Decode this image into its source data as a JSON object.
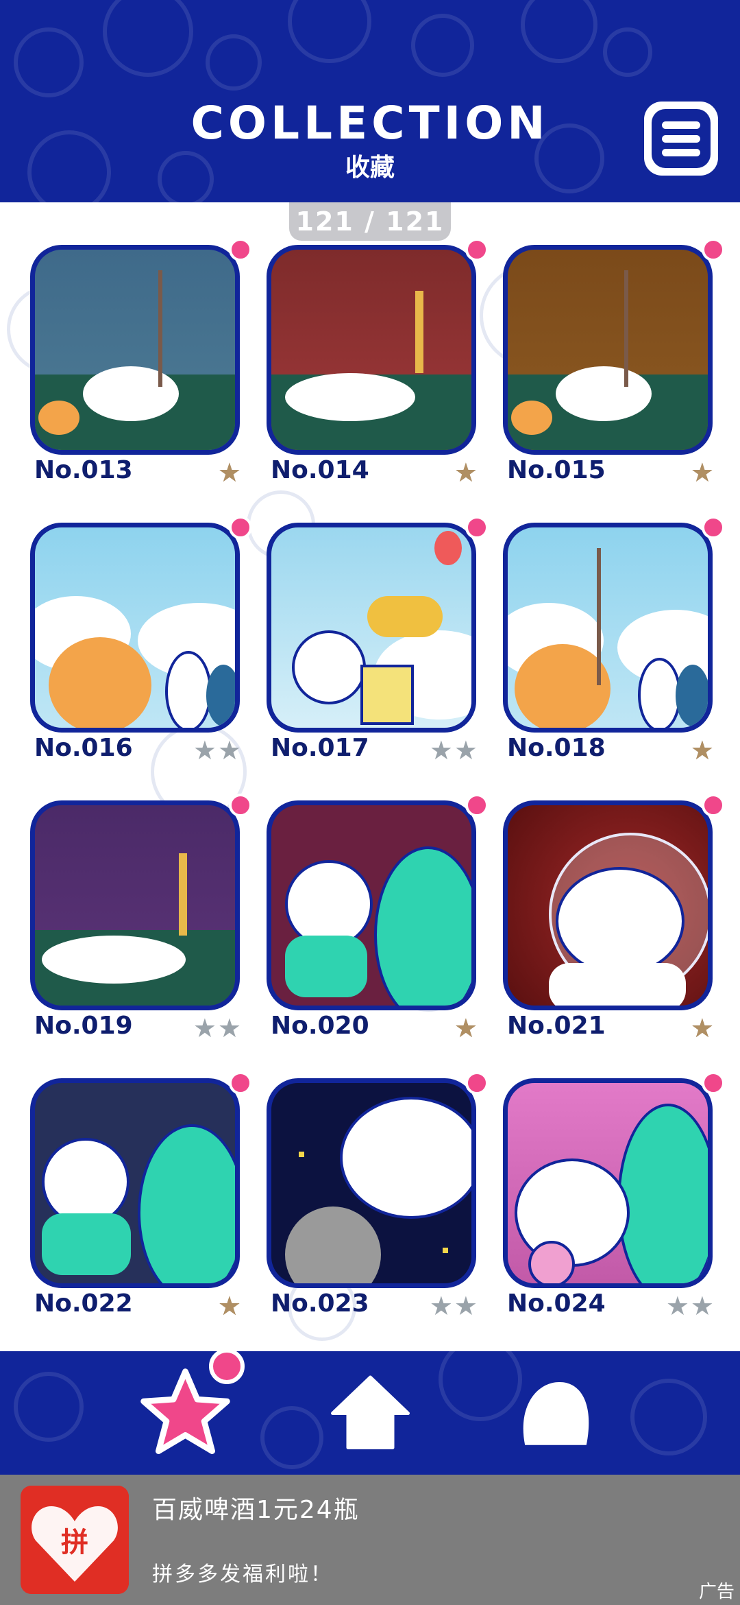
{
  "header": {
    "title": "COLLECTION",
    "subtitle": "收藏",
    "menu_icon": "hamburger-menu-icon",
    "background_color": "#11259a"
  },
  "counter": "121 / 121",
  "cards": [
    {
      "number": "No.013",
      "stars": "gold",
      "star_count": 1,
      "new_dot": true,
      "scene": "dog-sleeping-tree-night"
    },
    {
      "number": "No.014",
      "stars": "gold",
      "star_count": 1,
      "new_dot": true,
      "scene": "dog-lying-giraffe-red"
    },
    {
      "number": "No.015",
      "stars": "gold",
      "star_count": 1,
      "new_dot": true,
      "scene": "dog-sleeping-tree-brown"
    },
    {
      "number": "No.016",
      "stars": "silver",
      "star_count": 2,
      "new_dot": true,
      "scene": "fluffy-blue-sky"
    },
    {
      "number": "No.017",
      "stars": "silver",
      "star_count": 2,
      "new_dot": true,
      "scene": "giraffe-balloon"
    },
    {
      "number": "No.018",
      "stars": "gold",
      "star_count": 1,
      "new_dot": true,
      "scene": "fluffy-tree-sky"
    },
    {
      "number": "No.019",
      "stars": "silver",
      "star_count": 2,
      "new_dot": true,
      "scene": "dog-lying-giraffe-purple"
    },
    {
      "number": "No.020",
      "stars": "gold",
      "star_count": 1,
      "new_dot": true,
      "scene": "astronaut-alien"
    },
    {
      "number": "No.021",
      "stars": "gold",
      "star_count": 1,
      "new_dot": true,
      "scene": "astronaut-helmet-red"
    },
    {
      "number": "No.022",
      "stars": "gold",
      "star_count": 1,
      "new_dot": true,
      "scene": "astronaut-alien-dark"
    },
    {
      "number": "No.023",
      "stars": "silver",
      "star_count": 2,
      "new_dot": true,
      "scene": "space-float"
    },
    {
      "number": "No.024",
      "stars": "silver",
      "star_count": 2,
      "new_dot": true,
      "scene": "alien-hearts-pink"
    }
  ],
  "bottom_nav": {
    "items": [
      {
        "icon": "star-icon",
        "active": true
      },
      {
        "icon": "home-icon",
        "active": false
      },
      {
        "icon": "character-icon",
        "active": false
      }
    ],
    "accent": "#f0478a"
  },
  "ad": {
    "logo": "pinduoduo-logo",
    "logo_text": "拼",
    "title": "百威啤酒1元24瓶",
    "subtitle": "拼多多发福利啦！",
    "tag": "广告"
  }
}
